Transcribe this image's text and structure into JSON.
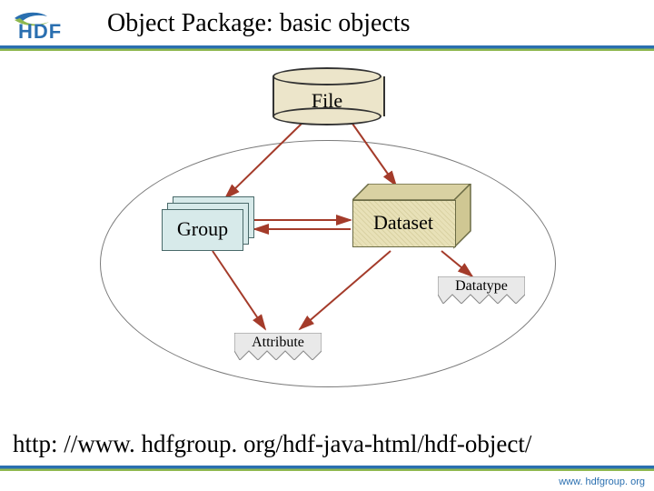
{
  "header": {
    "title": "Object Package: basic objects",
    "logo_text": "HDF"
  },
  "diagram": {
    "file_label": "File",
    "group_label": "Group",
    "dataset_label": "Dataset",
    "datatype_label": "Datatype",
    "attribute_label": "Attribute"
  },
  "links": {
    "page_url": "http: //www. hdfgroup. org/hdf-java-html/hdf-object/",
    "footer_url": "www. hdfgroup. org"
  },
  "colors": {
    "blue": "#2a6fb0",
    "green": "#8fb84f",
    "cylinder_fill": "#ece5ca",
    "group_fill": "#d7eaea",
    "arrow": "#a43b2a"
  }
}
